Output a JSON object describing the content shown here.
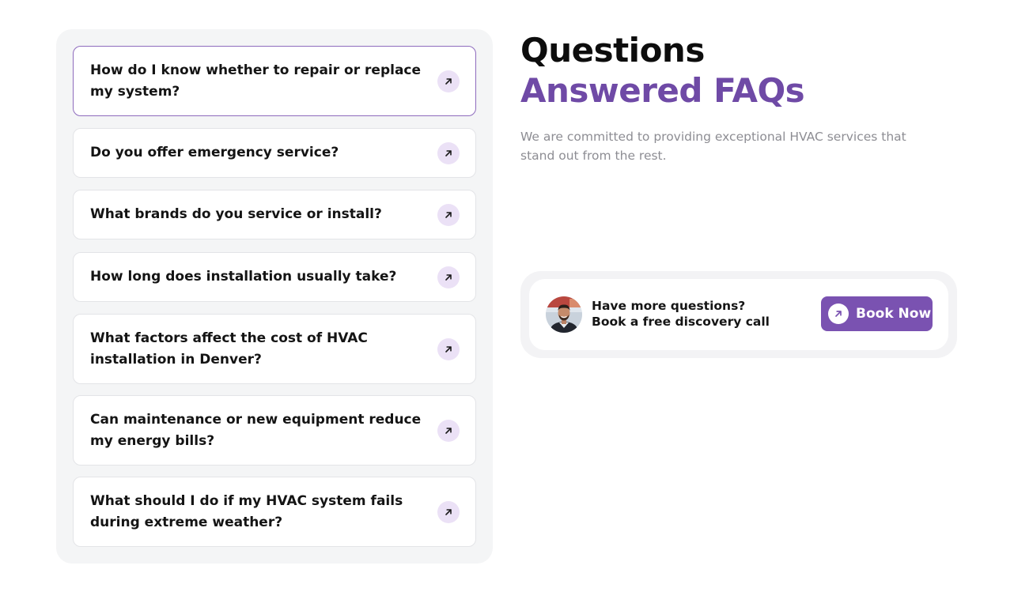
{
  "faq": {
    "items": [
      {
        "question": "How do I know whether to repair or replace my system?",
        "active": true,
        "icon": "arrow-up-right-icon"
      },
      {
        "question": "Do you offer emergency service?",
        "active": false,
        "icon": "arrow-up-right-icon"
      },
      {
        "question": "What brands do you service or install?",
        "active": false,
        "icon": "arrow-up-right-icon"
      },
      {
        "question": "How long does installation usually take?",
        "active": false,
        "icon": "arrow-up-right-icon"
      },
      {
        "question": "What factors affect the cost of HVAC installation in Denver?",
        "active": false,
        "icon": "arrow-up-right-icon"
      },
      {
        "question": "Can maintenance or new equipment reduce my energy bills?",
        "active": false,
        "icon": "arrow-up-right-icon"
      },
      {
        "question": "What should I do if my HVAC system fails during extreme weather?",
        "active": false,
        "icon": "arrow-up-right-icon"
      }
    ]
  },
  "header": {
    "title_line1": "Questions",
    "title_line2": "Answered FAQs",
    "description": "We are committed to providing exceptional HVAC services that stand out from the rest."
  },
  "cta": {
    "line1": "Have more questions?",
    "line2": "Book a free discovery call",
    "button_label": "Book Now",
    "button_icon": "arrow-up-right-icon",
    "avatar": "person-avatar"
  },
  "colors": {
    "accent": "#7a52b1",
    "accent_text": "#6f4aa6",
    "arrow_bg": "#ebe1f6",
    "active_border": "#8e6bbd",
    "panel_bg": "#f4f5f6"
  }
}
